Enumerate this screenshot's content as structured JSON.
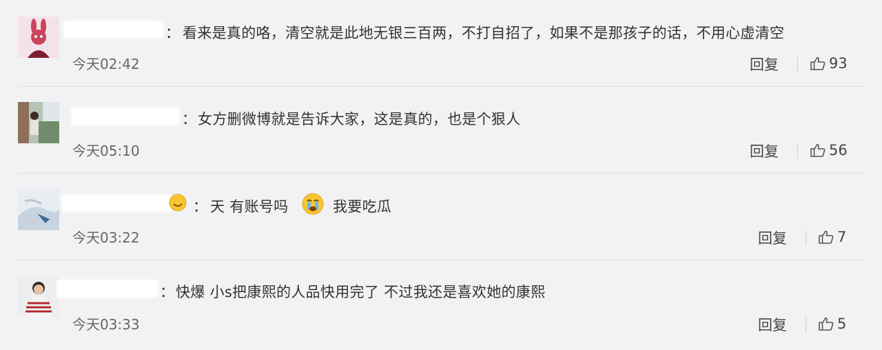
{
  "comments": [
    {
      "separator": "：",
      "text": "看来是真的咯，清空就是此地无银三百两，不打自招了，如果不是那孩子的话，不用心虚清空",
      "time": "今天02:42",
      "reply_label": "回复",
      "likes": "93"
    },
    {
      "separator": "：",
      "text": "女方删微博就是告诉大家，这是真的，也是个狠人",
      "time": "今天05:10",
      "reply_label": "回复",
      "likes": "56"
    },
    {
      "separator": "：",
      "text_part1": "天 有账号吗",
      "text_part2": "我要吃瓜",
      "time": "今天03:22",
      "reply_label": "回复",
      "likes": "7"
    },
    {
      "separator": "：",
      "text": "快爆 小s把康熙的人品快用完了 不过我还是喜欢她的康熙",
      "time": "今天03:33",
      "reply_label": "回复",
      "likes": "5"
    }
  ]
}
